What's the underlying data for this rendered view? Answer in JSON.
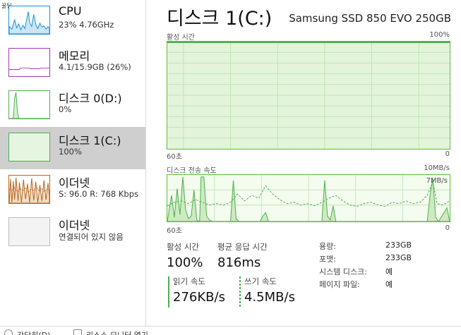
{
  "corner_label": "꿀팁",
  "sidebar": {
    "items": [
      {
        "title": "CPU",
        "sub": "23%  4.76GHz",
        "color": "#1a8fd9"
      },
      {
        "title": "메모리",
        "sub": "4.1/15.9GB (26%)",
        "color": "#a23ab5"
      },
      {
        "title": "디스크 0(D:)",
        "sub": "0%",
        "color": "#4caf50"
      },
      {
        "title": "디스크 1(C:)",
        "sub": "100%",
        "color": "#4caf50"
      },
      {
        "title": "이더넷",
        "sub": "S: 96.0  R: 768 Kbps",
        "color": "#b5651d"
      },
      {
        "title": "이더넷",
        "sub": "연결되어 있지 않음",
        "color": "#bbbbbb"
      }
    ]
  },
  "main": {
    "title": "디스크 1(C:)",
    "model": "Samsung SSD 850 EVO 250GB",
    "active_chart": {
      "label": "활성 시간",
      "max": "100%",
      "time_label": "60초",
      "zero": "0"
    },
    "transfer_chart": {
      "label": "디스크 전송 속도",
      "max": "10MB/s",
      "inner_mark": "7MB/s",
      "time_label": "60초",
      "zero": "0"
    },
    "stats": {
      "active_label": "활성 시간",
      "active_value": "100%",
      "response_label": "평균 응답 시간",
      "response_value": "816ms",
      "read_label": "읽기 속도",
      "read_value": "276KB/s",
      "write_label": "쓰기 속도",
      "write_value": "4.5MB/s"
    },
    "info": [
      {
        "key": "용량:",
        "value": "233GB"
      },
      {
        "key": "포맷:",
        "value": "233GB"
      },
      {
        "key": "시스템 디스크:",
        "value": "예"
      },
      {
        "key": "페이지 파일:",
        "value": "예"
      }
    ]
  },
  "footer": {
    "less_label": "간단히(D)",
    "resmon_label": "리소스 모니터 열기"
  }
}
